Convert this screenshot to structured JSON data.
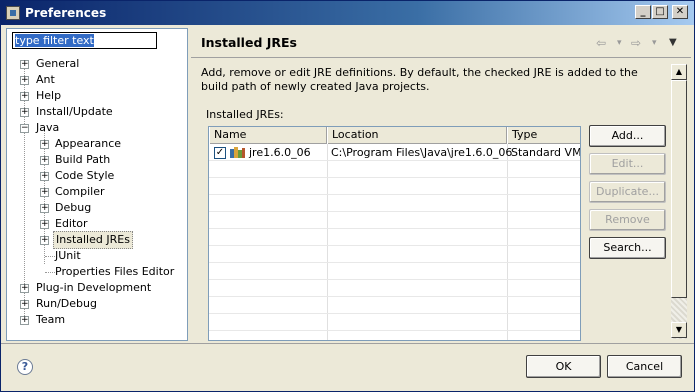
{
  "window": {
    "title": "Preferences",
    "min": "_",
    "max": "□",
    "close": "✕"
  },
  "filter": {
    "value": "type filter text"
  },
  "tree": [
    {
      "label": "General",
      "exp": "+"
    },
    {
      "label": "Ant",
      "exp": "+"
    },
    {
      "label": "Help",
      "exp": "+"
    },
    {
      "label": "Install/Update",
      "exp": "+"
    },
    {
      "label": "Java",
      "exp": "−"
    },
    {
      "label": "Appearance",
      "exp": "+"
    },
    {
      "label": "Build Path",
      "exp": "+"
    },
    {
      "label": "Code Style",
      "exp": "+"
    },
    {
      "label": "Compiler",
      "exp": "+"
    },
    {
      "label": "Debug",
      "exp": "+"
    },
    {
      "label": "Editor",
      "exp": "+"
    },
    {
      "label": "Installed JREs",
      "exp": "+"
    },
    {
      "label": "JUnit"
    },
    {
      "label": "Properties Files Editor"
    },
    {
      "label": "Plug-in Development",
      "exp": "+"
    },
    {
      "label": "Run/Debug",
      "exp": "+"
    },
    {
      "label": "Team",
      "exp": "+"
    }
  ],
  "page": {
    "title": "Installed JREs",
    "nav": {
      "back": "⇦",
      "forward": "⇨",
      "drop1": "▾",
      "drop2": "▾",
      "menu": "▼"
    },
    "description": "Add, remove or edit JRE definitions. By default, the checked JRE is added to the build path of newly created Java projects.",
    "installed_label": "Installed JREs:"
  },
  "table": {
    "columns": [
      "Name",
      "Location",
      "Type"
    ],
    "rows": [
      {
        "checked": "✓",
        "name": "jre1.6.0_06",
        "location": "C:\\Program Files\\Java\\jre1.6.0_06",
        "type": "Standard VM"
      }
    ]
  },
  "buttons": {
    "add": "Add...",
    "edit": "Edit...",
    "duplicate": "Duplicate...",
    "remove": "Remove",
    "search": "Search..."
  },
  "scroll": {
    "up": "▲",
    "down": "▼"
  },
  "dialog": {
    "help": "?",
    "ok": "OK",
    "cancel": "Cancel"
  },
  "icons": {
    "app": "window-icon",
    "jre": "jre-library-icon",
    "help": "help-icon"
  }
}
